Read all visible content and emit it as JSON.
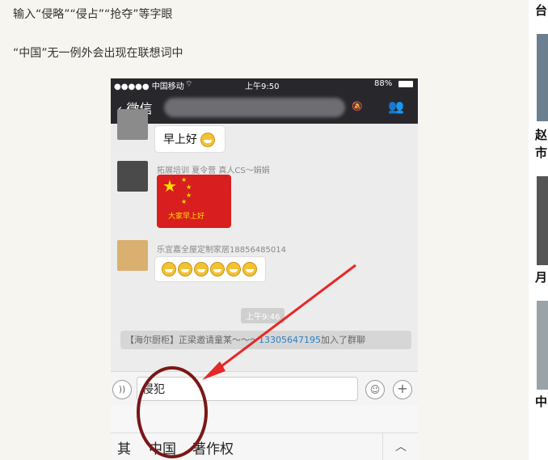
{
  "article": {
    "line1": "输入“侵略”“侵占”“抢夺”等字眼",
    "line2": "“中国”无一例外会出现在联想词中"
  },
  "phone": {
    "status": {
      "carrier": "●●●●● 中国移动",
      "wifi": "⌔",
      "time": "上午9:50",
      "battery": "88%"
    },
    "nav": {
      "back_label": "微信",
      "mute_icon": "🔕",
      "people_icon": "👥"
    },
    "messages": [
      {
        "text": "早上好"
      },
      {
        "name": "拓展培训 夏令营 真人CS～娟娟",
        "image_text": "大家早上好"
      },
      {
        "name": "乐宜嘉全屋定制家居18856485014",
        "emoji_count": 6
      }
    ],
    "time_label": "上午9:46",
    "system": {
      "prefix": "【海尔厨柜】正梁邀请童某",
      "tilde": "～～～",
      "number": "13305647195",
      "suffix": "加入了群聊"
    },
    "input": {
      "text": "侵犯",
      "voice_icon": "))",
      "emoji_icon": "☺",
      "plus_icon": "+"
    },
    "candidates": [
      "其",
      "中国",
      "著作权"
    ],
    "collapse_icon": "︿"
  },
  "sidebar": {
    "items": [
      "台",
      "赵",
      "市",
      "月",
      "中"
    ]
  }
}
